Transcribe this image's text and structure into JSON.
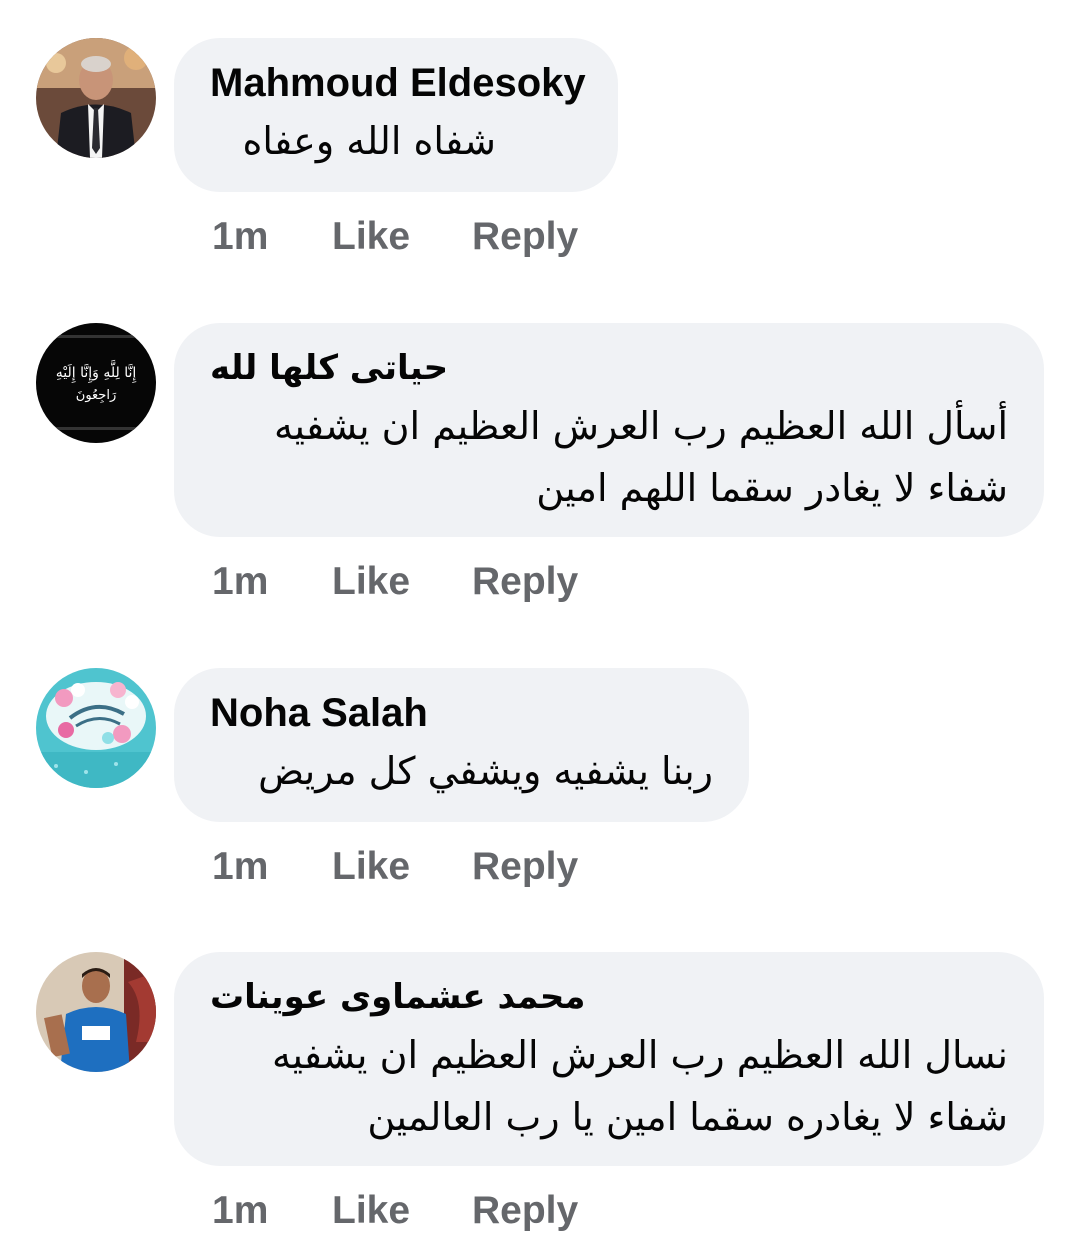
{
  "comments": [
    {
      "author": "Mahmoud Eldesoky",
      "text_lines": [
        "شفاه الله وعفاه"
      ],
      "time": "1m",
      "like_label": "Like",
      "reply_label": "Reply"
    },
    {
      "author": "حياتى كلها لله",
      "text_lines": [
        "أسأل الله العظيم رب العرش العظيم ان يشفيه",
        "شفاء لا يغادر سقما اللهم امين"
      ],
      "time": "1m",
      "like_label": "Like",
      "reply_label": "Reply",
      "avatar_text": [
        "إِنَّا لِلَّهِ وَإِنَّا إِلَيْهِ",
        "رَاجِعُونَ"
      ]
    },
    {
      "author": "Noha Salah",
      "text_lines": [
        "ربنا يشفيه ويشفي كل مريض"
      ],
      "time": "1m",
      "like_label": "Like",
      "reply_label": "Reply"
    },
    {
      "author": "محمد عشماوى عوينات",
      "text_lines": [
        "نسال الله العظيم رب العرش العظيم ان يشفيه",
        "شفاء لا يغادره سقما امين يا رب العالمين"
      ],
      "time": "1m",
      "like_label": "Like",
      "reply_label": "Reply"
    }
  ],
  "colors": {
    "bubble": "#f0f2f5",
    "text": "#050505",
    "meta": "#65676b"
  }
}
